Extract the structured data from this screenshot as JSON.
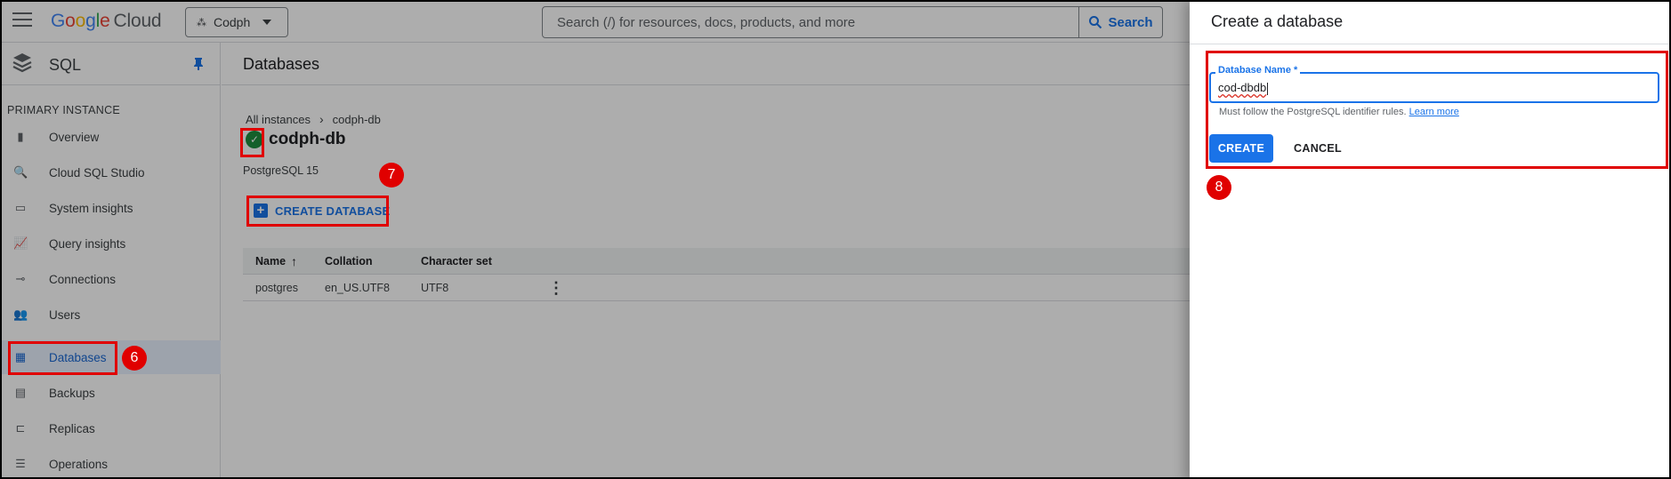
{
  "topbar": {
    "logo_letters": [
      "G",
      "o",
      "o",
      "g",
      "l",
      "e"
    ],
    "logo_cloud": "Cloud",
    "project": "Codph",
    "search_placeholder": "Search (/) for resources, docs, products, and more",
    "search_button": "Search"
  },
  "sidenav": {
    "product": "SQL",
    "section": "PRIMARY INSTANCE",
    "items": [
      {
        "label": "Overview",
        "icon": "overview-icon",
        "glyph": "▮"
      },
      {
        "label": "Cloud SQL Studio",
        "icon": "search-icon",
        "glyph": "🔍"
      },
      {
        "label": "System insights",
        "icon": "monitor-icon",
        "glyph": "▭"
      },
      {
        "label": "Query insights",
        "icon": "chart-icon",
        "glyph": "📈"
      },
      {
        "label": "Connections",
        "icon": "connection-icon",
        "glyph": "⊸"
      },
      {
        "label": "Users",
        "icon": "users-icon",
        "glyph": "👥"
      },
      {
        "label": "Databases",
        "icon": "database-grid-icon",
        "glyph": "▦",
        "active": true
      },
      {
        "label": "Backups",
        "icon": "backup-icon",
        "glyph": "▤"
      },
      {
        "label": "Replicas",
        "icon": "replica-icon",
        "glyph": "⊏"
      },
      {
        "label": "Operations",
        "icon": "list-icon",
        "glyph": "☰"
      }
    ]
  },
  "main": {
    "title": "Databases",
    "breadcrumb": [
      "All instances",
      "codph-db"
    ],
    "instance_name": "codph-db",
    "db_version": "PostgreSQL 15",
    "create_button": "CREATE DATABASE",
    "table": {
      "headers": [
        "Name",
        "Collation",
        "Character set"
      ],
      "rows": [
        {
          "name": "postgres",
          "collation": "en_US.UTF8",
          "charset": "UTF8"
        }
      ]
    }
  },
  "panel": {
    "title": "Create a database",
    "field_label": "Database Name *",
    "field_value": "cod-dbdb",
    "hint": "Must follow the PostgreSQL identifier rules.",
    "hint_link": "Learn more",
    "create": "CREATE",
    "cancel": "CANCEL"
  },
  "annotations": {
    "step6": "6",
    "step7": "7",
    "step8": "8",
    "color": "#e00000"
  },
  "colors": {
    "accent": "#1a73e8",
    "status_ok": "#1e8e3e"
  }
}
